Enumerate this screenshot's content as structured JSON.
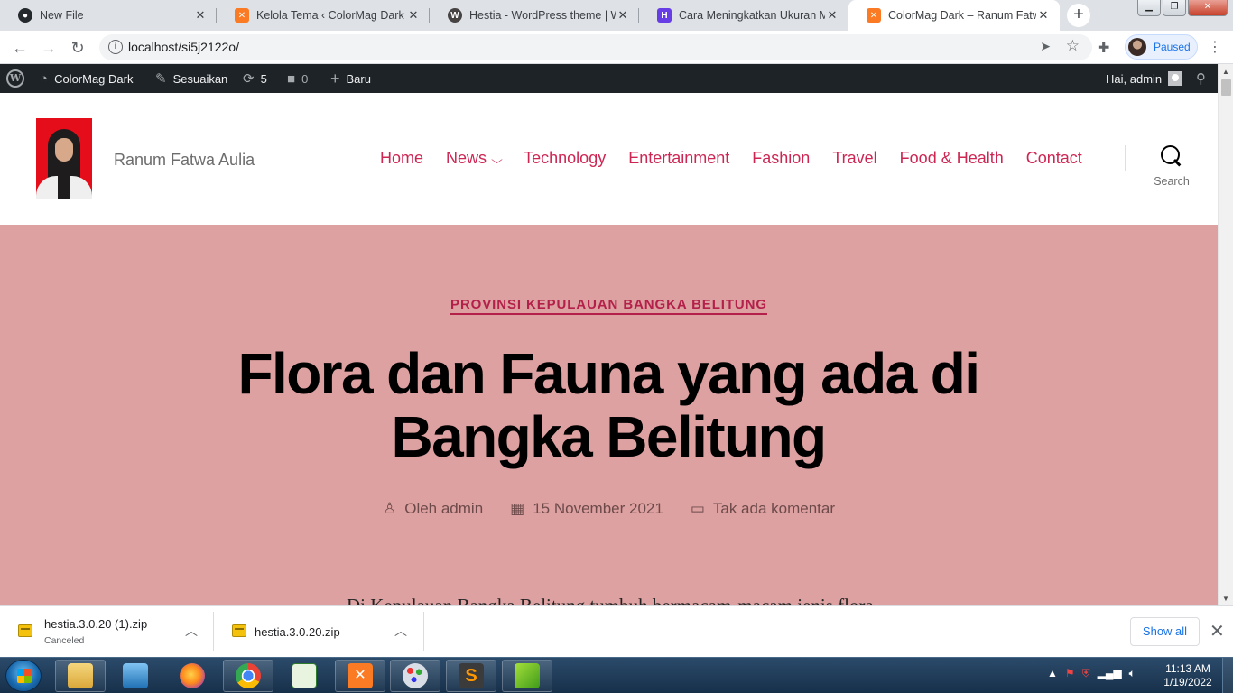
{
  "browser": {
    "tabs": [
      {
        "title": "New File",
        "icon": "github-icon"
      },
      {
        "title": "Kelola Tema ‹ ColorMag Dark —",
        "icon": "xampp-icon"
      },
      {
        "title": "Hestia - WordPress theme | Wor",
        "icon": "wordpress-icon"
      },
      {
        "title": "Cara Meningkatkan Ukuran Ma:",
        "icon": "hostinger-icon"
      },
      {
        "title": "ColorMag Dark – Ranum Fatwa",
        "icon": "xampp-icon"
      }
    ],
    "url": "localhost/si5j2122o/",
    "profile_status": "Paused"
  },
  "admin_bar": {
    "site_name": "ColorMag Dark",
    "customize": "Sesuaikan",
    "updates_count": "5",
    "comments_count": "0",
    "new_label": "Baru",
    "greeting": "Hai, admin"
  },
  "site": {
    "title": "Ranum Fatwa Aulia",
    "nav": [
      "Home",
      "News",
      "Technology",
      "Entertainment",
      "Fashion",
      "Travel",
      "Food & Health",
      "Contact"
    ],
    "search_label": "Search"
  },
  "post": {
    "category": "PROVINSI KEPULAUAN BANGKA BELITUNG",
    "title": "Flora dan Fauna yang ada di Bangka Belitung",
    "author": "Oleh admin",
    "date": "15 November 2021",
    "comments": "Tak ada komentar",
    "excerpt_start": "Di Kepulauan Bangka Belitung tumbuh bermacam-macam jenis flora"
  },
  "downloads": {
    "items": [
      {
        "name": "hestia.3.0.20 (1).zip",
        "status": "Canceled"
      },
      {
        "name": "hestia.3.0.20.zip",
        "status": ""
      }
    ],
    "show_all": "Show all"
  },
  "taskbar": {
    "time": "11:13 AM",
    "date": "1/19/2022"
  },
  "colors": {
    "accent": "#cd2653",
    "hero_bg": "#dea1a1",
    "admin_bar": "#1d2327"
  }
}
